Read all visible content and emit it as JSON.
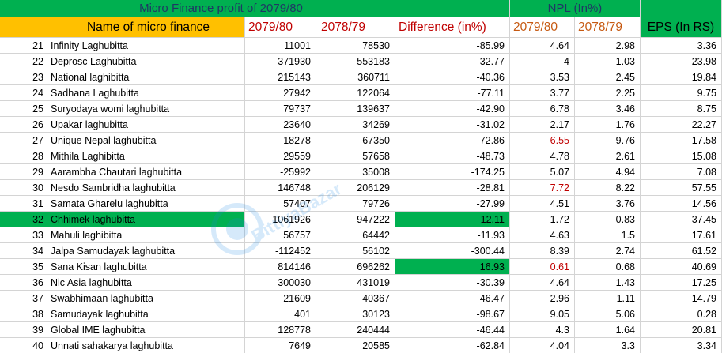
{
  "colors": {
    "header_yellow": "#ffc000",
    "header_green": "#00b050",
    "highlight_green": "#00b050",
    "header_red_text": "#c00000",
    "header_brown_text": "#c65911",
    "npl_red_text": "#c00000",
    "title_text": "#1f3864",
    "gridline": "#d4d4d4"
  },
  "header": {
    "profit_title": "Micro Finance profit of 2079/80",
    "npl_title": "NPL (In%)",
    "name_col": "Name of micro finance",
    "profit_2079": "2079/80",
    "profit_2078": "2078/79",
    "difference": "Difference (in%)",
    "npl_2079": "2079/80",
    "npl_2078": "2078/79",
    "eps": "EPS (In RS)"
  },
  "watermark": {
    "text": "BittiyaBazar"
  },
  "rows": [
    {
      "sn": "21",
      "name": "Infinity Laghubitta",
      "p2079": "11001",
      "p2078": "78530",
      "diff": "-85.99",
      "npl2079": "4.64",
      "npl2078": "2.98",
      "eps": "3.36"
    },
    {
      "sn": "22",
      "name": "Deprosc Laghubitta",
      "p2079": "371930",
      "p2078": "553183",
      "diff": "-32.77",
      "npl2079": "4",
      "npl2078": "1.03",
      "eps": "23.98"
    },
    {
      "sn": "23",
      "name": "National laghibitta",
      "p2079": "215143",
      "p2078": "360711",
      "diff": "-40.36",
      "npl2079": "3.53",
      "npl2078": "2.45",
      "eps": "19.84"
    },
    {
      "sn": "24",
      "name": "Sadhana Laghubitta",
      "p2079": "27942",
      "p2078": "122064",
      "diff": "-77.11",
      "npl2079": "3.77",
      "npl2078": "2.25",
      "eps": "9.75"
    },
    {
      "sn": "25",
      "name": "Suryodaya womi laghubitta",
      "p2079": "79737",
      "p2078": "139637",
      "diff": "-42.90",
      "npl2079": "6.78",
      "npl2078": "3.46",
      "eps": "8.75"
    },
    {
      "sn": "26",
      "name": "Upakar laghubitta",
      "p2079": "23640",
      "p2078": "34269",
      "diff": "-31.02",
      "npl2079": "2.17",
      "npl2078": "1.76",
      "eps": "22.27"
    },
    {
      "sn": "27",
      "name": "Unique Nepal laghubitta",
      "p2079": "18278",
      "p2078": "67350",
      "diff": "-72.86",
      "npl2079": "6.55",
      "npl2078": "9.76",
      "eps": "17.58",
      "npl_red": true
    },
    {
      "sn": "28",
      "name": "Mithila Laghibitta",
      "p2079": "29559",
      "p2078": "57658",
      "diff": "-48.73",
      "npl2079": "4.78",
      "npl2078": "2.61",
      "eps": "15.08"
    },
    {
      "sn": "29",
      "name": "Aarambha Chautari laghubitta",
      "p2079": "-25992",
      "p2078": "35008",
      "diff": "-174.25",
      "npl2079": "5.07",
      "npl2078": "4.94",
      "eps": "7.08"
    },
    {
      "sn": "30",
      "name": "Nesdo Sambridha laghubitta",
      "p2079": "146748",
      "p2078": "206129",
      "diff": "-28.81",
      "npl2079": "7.72",
      "npl2078": "8.22",
      "eps": "57.55",
      "npl_red": true
    },
    {
      "sn": "31",
      "name": "Samata Gharelu laghubitta",
      "p2079": "57407",
      "p2078": "79726",
      "diff": "-27.99",
      "npl2079": "4.51",
      "npl2078": "3.76",
      "eps": "14.56"
    },
    {
      "sn": "32",
      "name": "Chhimek laghubitta",
      "p2079": "1061926",
      "p2078": "947222",
      "diff": "12.11",
      "npl2079": "1.72",
      "npl2078": "0.83",
      "eps": "37.45",
      "row_green": true,
      "diff_green": true
    },
    {
      "sn": "33",
      "name": "Mahuli laghibitta",
      "p2079": "56757",
      "p2078": "64442",
      "diff": "-11.93",
      "npl2079": "4.63",
      "npl2078": "1.5",
      "eps": "17.61"
    },
    {
      "sn": "34",
      "name": "Jalpa Samudayak laghubitta",
      "p2079": "-112452",
      "p2078": "56102",
      "diff": "-300.44",
      "npl2079": "8.39",
      "npl2078": "2.74",
      "eps": "61.52"
    },
    {
      "sn": "35",
      "name": "Sana Kisan laghubitta",
      "p2079": "814146",
      "p2078": "696262",
      "diff": "16.93",
      "npl2079": "0.61",
      "npl2078": "0.68",
      "eps": "40.69",
      "diff_green": true,
      "npl_red": true
    },
    {
      "sn": "36",
      "name": "Nic Asia laghubitta",
      "p2079": "300030",
      "p2078": "431019",
      "diff": "-30.39",
      "npl2079": "4.64",
      "npl2078": "1.43",
      "eps": "17.25"
    },
    {
      "sn": "37",
      "name": "Swabhimaan laghubitta",
      "p2079": "21609",
      "p2078": "40367",
      "diff": "-46.47",
      "npl2079": "2.96",
      "npl2078": "1.11",
      "eps": "14.79"
    },
    {
      "sn": "38",
      "name": "Samudayak laghubitta",
      "p2079": "401",
      "p2078": "30123",
      "diff": "-98.67",
      "npl2079": "9.05",
      "npl2078": "5.06",
      "eps": "0.28"
    },
    {
      "sn": "39",
      "name": "Global IME laghubitta",
      "p2079": "128778",
      "p2078": "240444",
      "diff": "-46.44",
      "npl2079": "4.3",
      "npl2078": "1.64",
      "eps": "20.81"
    },
    {
      "sn": "40",
      "name": "Unnati sahakarya laghubitta",
      "p2079": "7649",
      "p2078": "20585",
      "diff": "-62.84",
      "npl2079": "4.04",
      "npl2078": "3.3",
      "eps": "3.34"
    }
  ]
}
